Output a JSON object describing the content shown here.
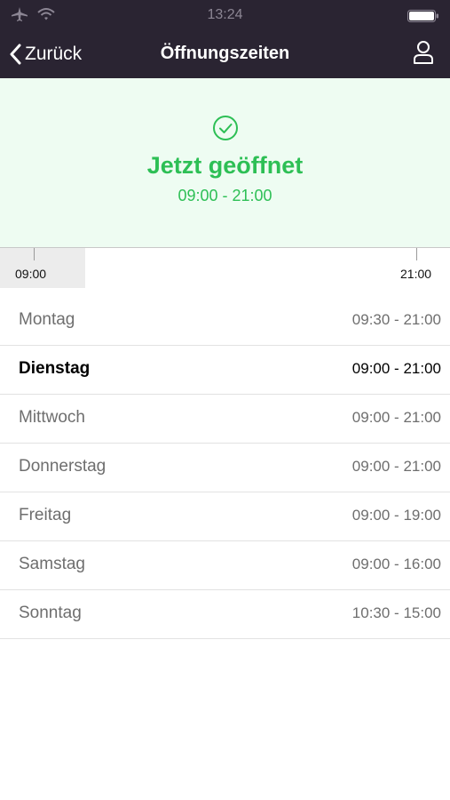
{
  "status_bar": {
    "time": "13:24",
    "icons": [
      "airplane-icon",
      "wifi-icon",
      "battery-icon"
    ]
  },
  "nav": {
    "back_label": "Zurück",
    "title": "Öffnungszeiten",
    "profile_icon": "person-icon"
  },
  "banner": {
    "status": "Jetzt geöffnet",
    "hours": "09:00 - 21:00",
    "icon": "check-circle-icon",
    "accent_color": "#2dbf55"
  },
  "timeline": {
    "start_label": "09:00",
    "end_label": "21:00"
  },
  "days": [
    {
      "name": "Montag",
      "hours": "09:30 - 21:00",
      "today": false
    },
    {
      "name": "Dienstag",
      "hours": "09:00 - 21:00",
      "today": true
    },
    {
      "name": "Mittwoch",
      "hours": "09:00 - 21:00",
      "today": false
    },
    {
      "name": "Donnerstag",
      "hours": "09:00 - 21:00",
      "today": false
    },
    {
      "name": "Freitag",
      "hours": "09:00 - 19:00",
      "today": false
    },
    {
      "name": "Samstag",
      "hours": "09:00 - 16:00",
      "today": false
    },
    {
      "name": "Sonntag",
      "hours": "10:30 - 15:00",
      "today": false
    }
  ]
}
